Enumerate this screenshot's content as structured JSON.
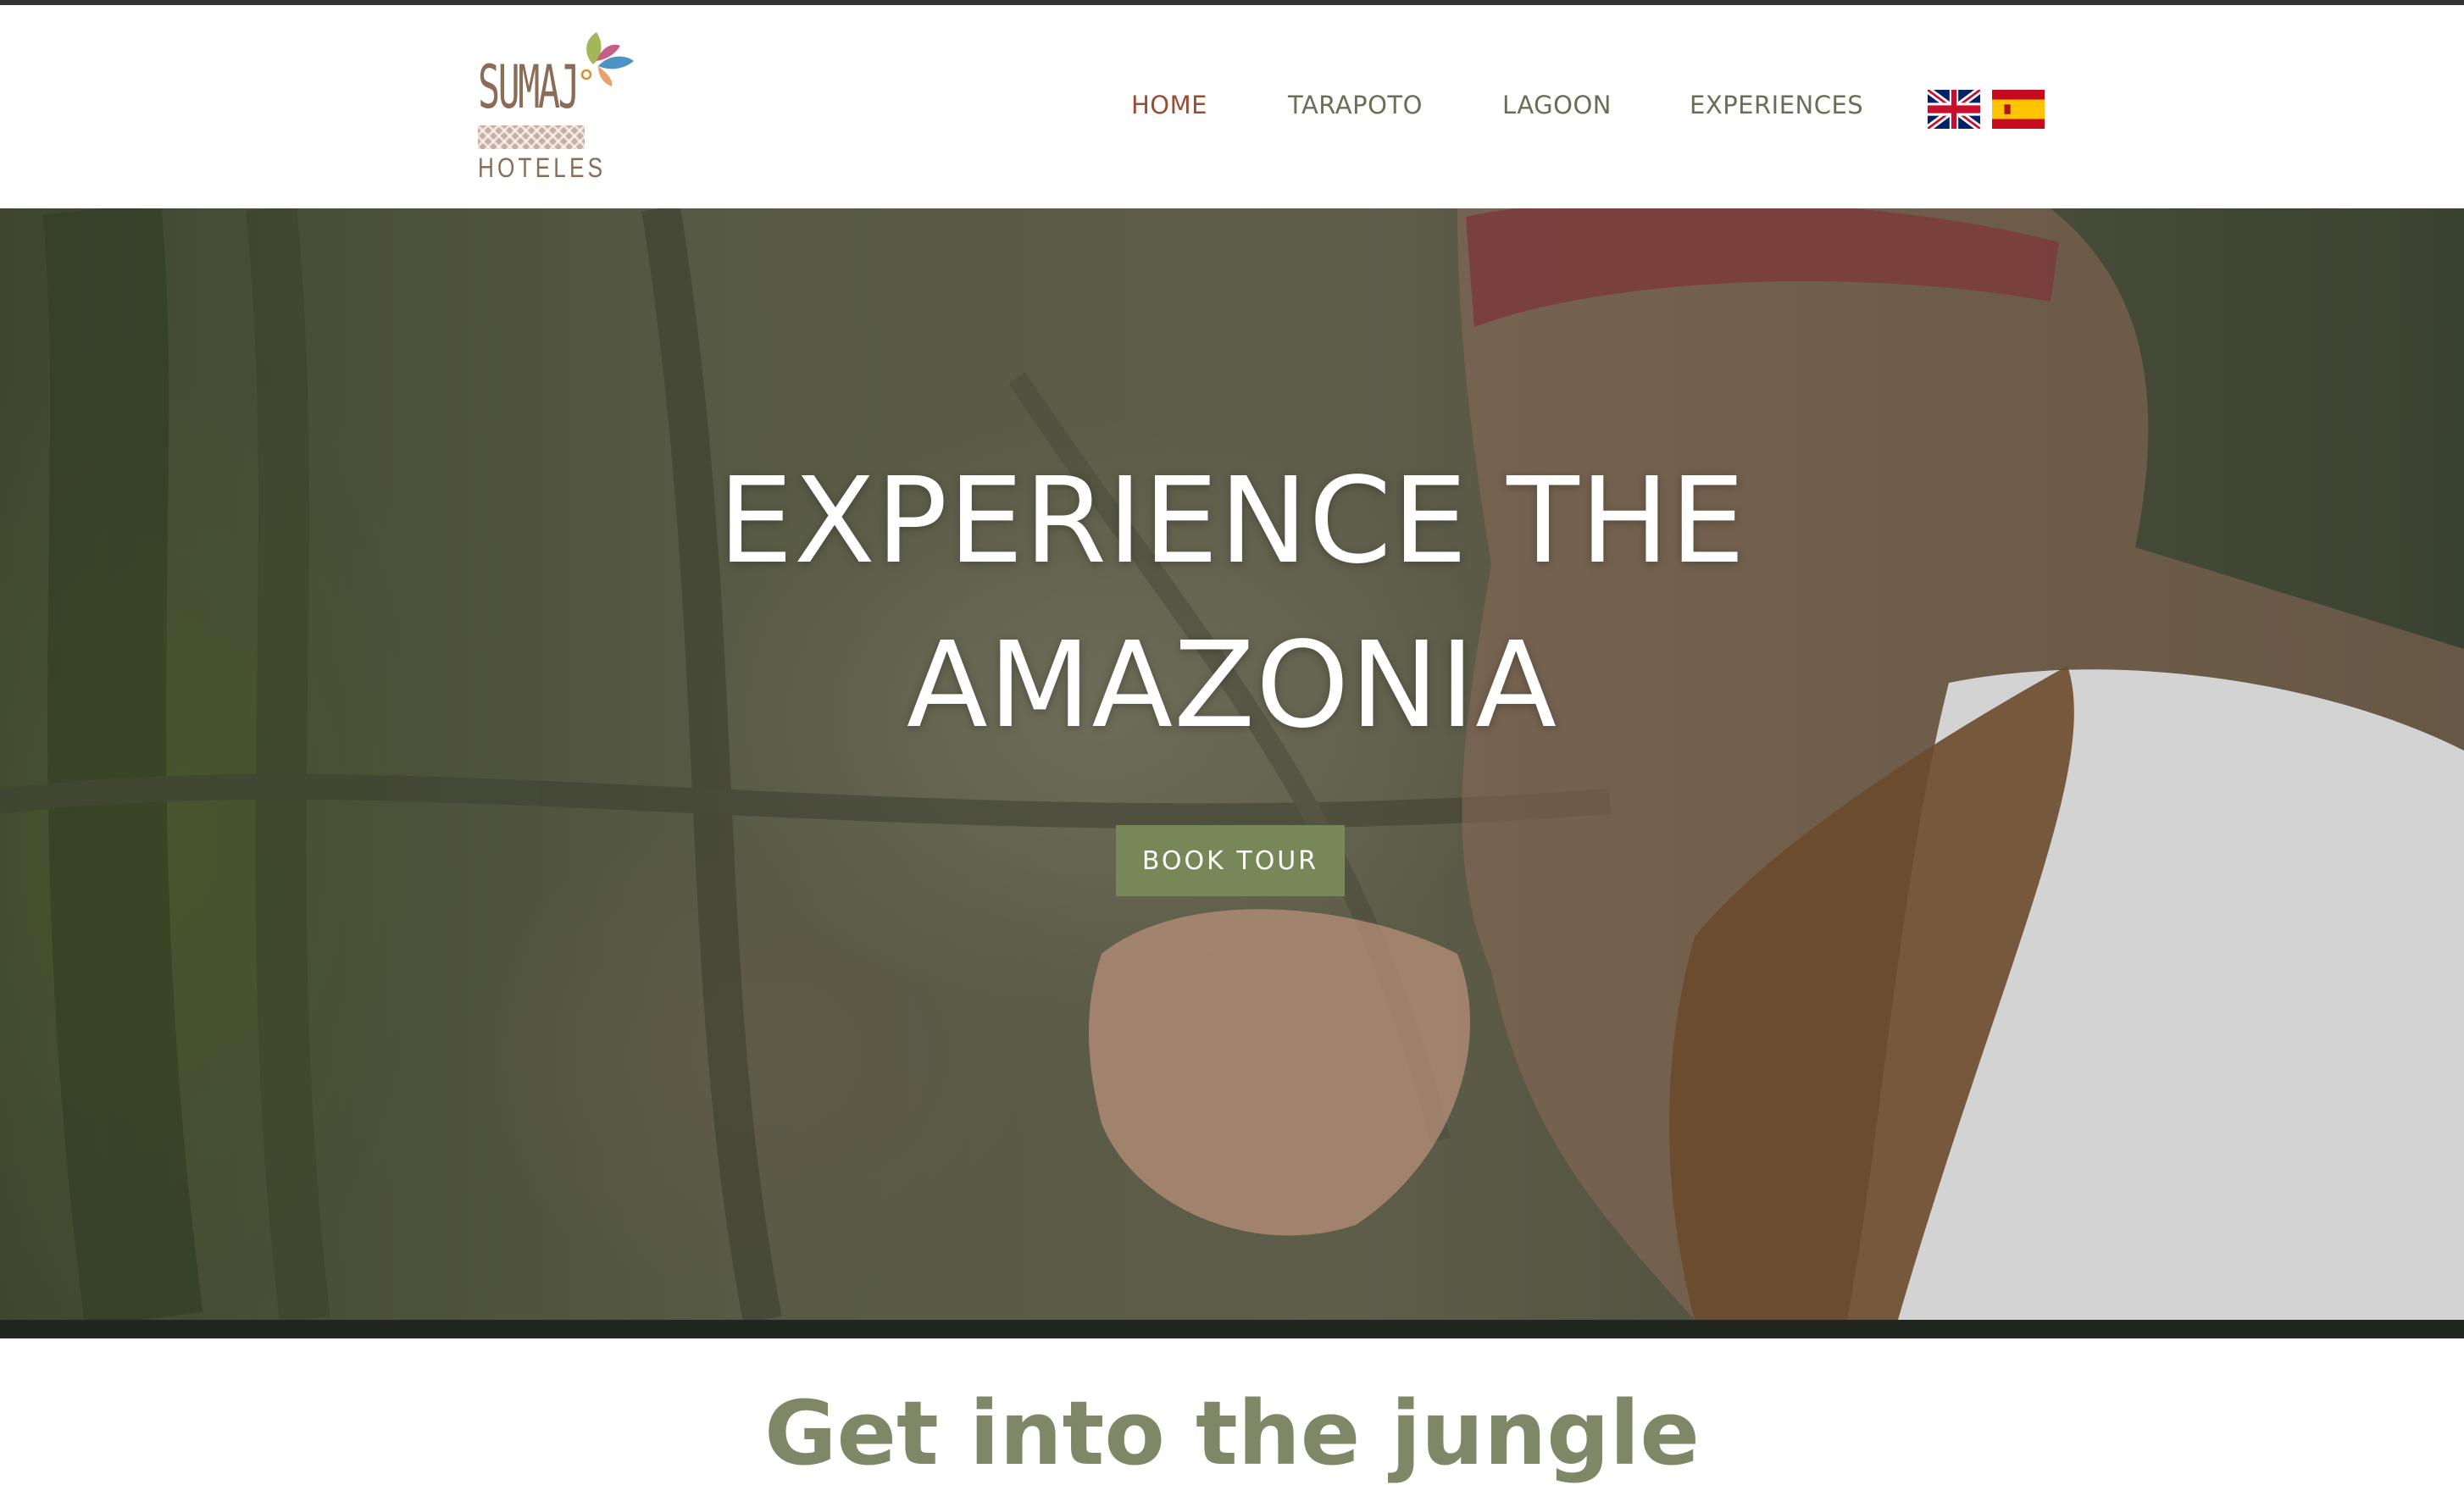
{
  "brand": {
    "logo_primary": "SUMAJ",
    "logo_secondary": "HOTELES"
  },
  "nav": {
    "items": [
      {
        "label": "HOME",
        "active": true
      },
      {
        "label": "TARAPOTO",
        "active": false
      },
      {
        "label": "LAGOON",
        "active": false
      },
      {
        "label": "EXPERIENCES",
        "active": false
      }
    ],
    "languages": [
      "english-flag-icon",
      "spain-flag-icon"
    ]
  },
  "hero": {
    "title_line_1": "EXPERIENCE THE",
    "title_line_2": "AMAZONIA",
    "cta_label": "BOOK TOUR"
  },
  "intro": {
    "heading": "Get into the jungle"
  },
  "colors": {
    "nav_text": "#6b6d55",
    "nav_active": "#9a4d33",
    "cta_background": "#778757",
    "heading": "#7e8866"
  }
}
